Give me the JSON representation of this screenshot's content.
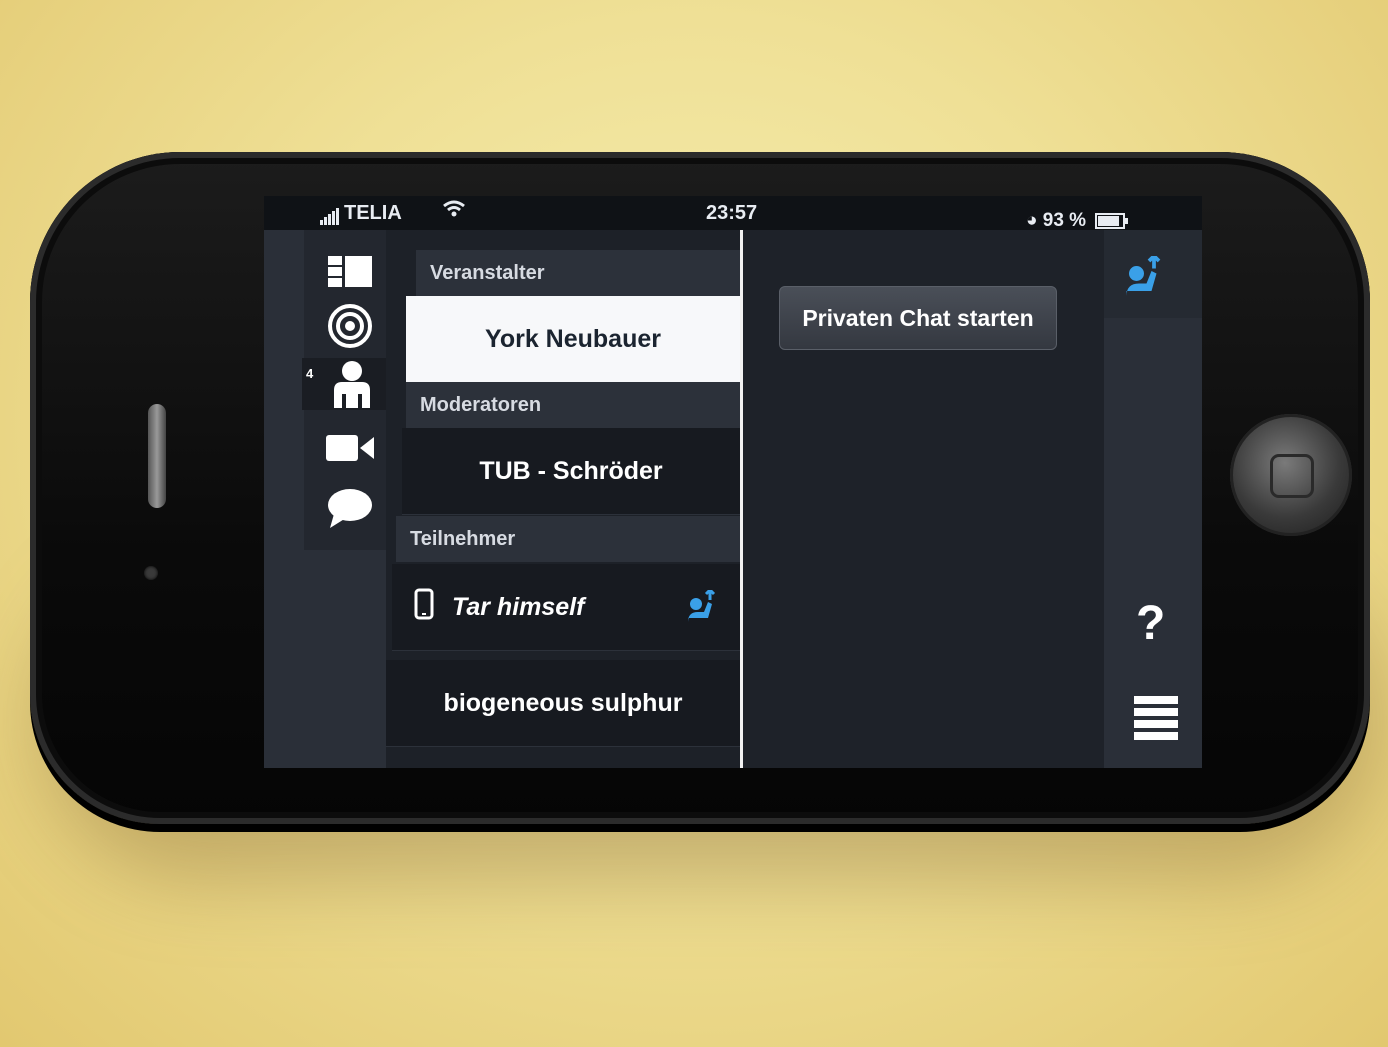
{
  "status_bar": {
    "carrier": "TELIA",
    "time": "23:57",
    "battery": "93 %"
  },
  "sidebar": {
    "icons": [
      "layout-icon",
      "target-icon",
      "participants-icon",
      "video-icon",
      "chat-icon"
    ],
    "participants_badge": "4"
  },
  "participants": {
    "organizer_header": "Veranstalter",
    "organizer": "York Neubauer",
    "moderators_header": "Moderatoren",
    "moderator": "TUB - Schröder",
    "participants_header": "Teilnehmer",
    "participant_1": "Tar himself",
    "participant_2": "biogeneous sulphur"
  },
  "main": {
    "private_chat_button": "Privaten Chat starten"
  },
  "rightbar": {
    "help_label": "?"
  },
  "colors": {
    "accent": "#3aa0e8",
    "selected_bg": "#f7f8fa",
    "panel_bg": "#1d2128"
  }
}
